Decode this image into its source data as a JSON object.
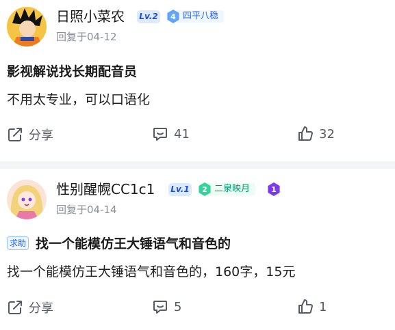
{
  "posts": [
    {
      "username": "日照小菜农",
      "level": "Lv.2",
      "medal": {
        "number": "4",
        "label": "四平八稳",
        "color": "#60a5fa",
        "bg": "#eff6ff",
        "fg": "#2563eb"
      },
      "reply_date": "回复于04-12",
      "title": "影视解说找长期配音员",
      "tag": "",
      "body": "不用太专业，可以口语化",
      "actions": {
        "share": "分享",
        "comments": "41",
        "likes": "32"
      }
    },
    {
      "username": "性别醒幌CC1c1",
      "level": "Lv.1",
      "medal": {
        "number": "2",
        "label": "二泉映月",
        "color": "#34d399",
        "bg": "#ecfdf5",
        "fg": "#059669"
      },
      "extra_badge": {
        "number": "1",
        "color": "#7c3aed"
      },
      "reply_date": "回复于04-14",
      "title": "找一个能模仿王大锤语气和音色的",
      "tag": "求助",
      "body": "找一个能模仿王大锤语气和音色的，160字，15元",
      "actions": {
        "share": "分享",
        "comments": "5",
        "likes": "1"
      }
    }
  ]
}
